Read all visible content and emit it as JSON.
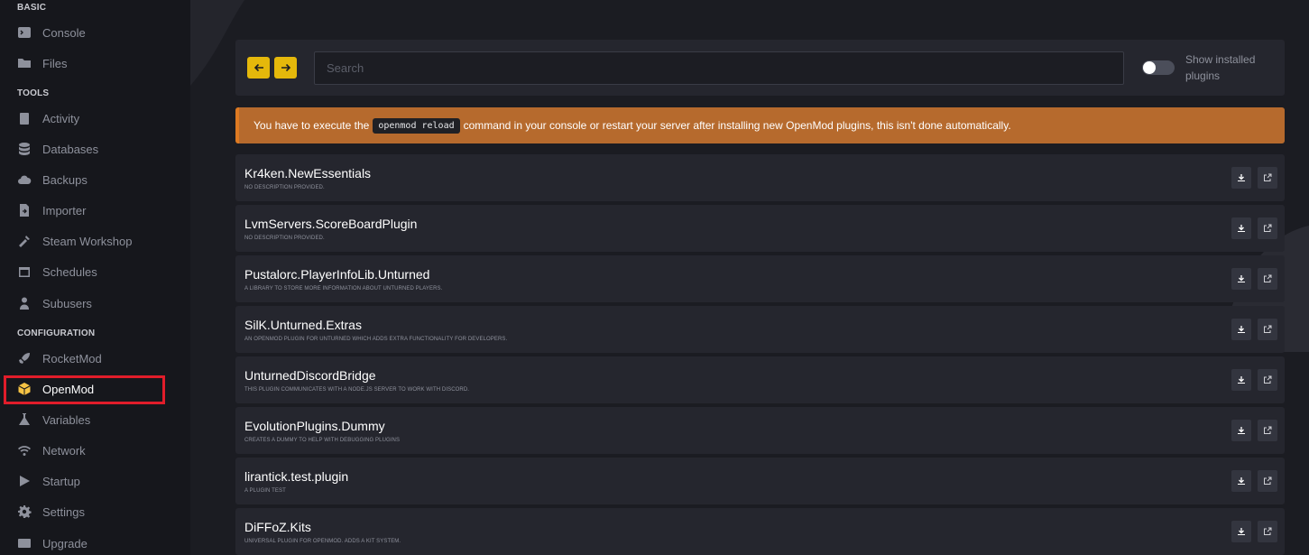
{
  "sidebar": {
    "sections": {
      "basic": "BASIC",
      "tools": "TOOLS",
      "configuration": "CONFIGURATION"
    },
    "items": [
      {
        "label": "Console",
        "icon": "terminal-icon"
      },
      {
        "label": "Files",
        "icon": "folder-icon"
      },
      {
        "label": "Activity",
        "icon": "clipboard-icon"
      },
      {
        "label": "Databases",
        "icon": "database-icon"
      },
      {
        "label": "Backups",
        "icon": "cloud-icon"
      },
      {
        "label": "Importer",
        "icon": "file-import-icon"
      },
      {
        "label": "Steam Workshop",
        "icon": "tools-icon"
      },
      {
        "label": "Schedules",
        "icon": "calendar-icon"
      },
      {
        "label": "Subusers",
        "icon": "user-icon"
      },
      {
        "label": "RocketMod",
        "icon": "rocket-icon"
      },
      {
        "label": "OpenMod",
        "icon": "cube-icon"
      },
      {
        "label": "Variables",
        "icon": "flask-icon"
      },
      {
        "label": "Network",
        "icon": "wifi-icon"
      },
      {
        "label": "Startup",
        "icon": "play-icon"
      },
      {
        "label": "Settings",
        "icon": "gear-icon"
      },
      {
        "label": "Upgrade",
        "icon": "upgrade-icon"
      }
    ],
    "active_item": "OpenMod"
  },
  "toolbar": {
    "search_placeholder": "Search",
    "toggle_label": "Show installed plugins",
    "toggle_on": false
  },
  "alert": {
    "prefix": "You have to execute the",
    "code": "openmod reload",
    "suffix": "command in your console or restart your server after installing new OpenMod plugins, this isn't done automatically."
  },
  "plugins": [
    {
      "name": "Kr4ken.NewEssentials",
      "description": "NO DESCRIPTION PROVIDED."
    },
    {
      "name": "LvmServers.ScoreBoardPlugin",
      "description": "NO DESCRIPTION PROVIDED."
    },
    {
      "name": "Pustalorc.PlayerInfoLib.Unturned",
      "description": "A LIBRARY TO STORE MORE INFORMATION ABOUT UNTURNED PLAYERS."
    },
    {
      "name": "SilK.Unturned.Extras",
      "description": "AN OPENMOD PLUGIN FOR UNTURNED WHICH ADDS EXTRA FUNCTIONALITY FOR DEVELOPERS."
    },
    {
      "name": "UnturnedDiscordBridge",
      "description": "THIS PLUGIN COMMUNICATES WITH A NODE.JS SERVER TO WORK WITH DISCORD."
    },
    {
      "name": "EvolutionPlugins.Dummy",
      "description": "CREATES A DUMMY TO HELP WITH DEBUGGING PLUGINS"
    },
    {
      "name": "lirantick.test.plugin",
      "description": "A PLUGIN TEST"
    },
    {
      "name": "DiFFoZ.Kits",
      "description": "UNIVERSAL PLUGIN FOR OPENMOD. ADDS A KIT SYSTEM."
    }
  ],
  "colors": {
    "accent": "#e5b80b",
    "alert": "#b66a2d",
    "highlight": "#e11d2a"
  }
}
